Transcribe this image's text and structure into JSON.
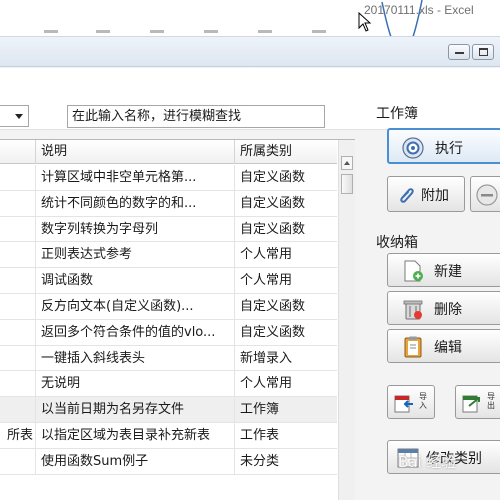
{
  "excel": {
    "title": "20170111.xls - Excel"
  },
  "search": {
    "placeholder": "在此输入名称，进行模糊查找"
  },
  "table": {
    "columns": [
      "说明",
      "所属类别"
    ],
    "rows": [
      {
        "name": "",
        "description": "计算区域中非空单元格第...",
        "category": "自定义函数"
      },
      {
        "name": "",
        "description": "统计不同颜色的数字的和...",
        "category": "自定义函数"
      },
      {
        "name": "",
        "description": "数字列转换为字母列",
        "category": "自定义函数"
      },
      {
        "name": "",
        "description": "正则表达式参考",
        "category": "个人常用"
      },
      {
        "name": "",
        "description": "调试函数",
        "category": "个人常用"
      },
      {
        "name": "",
        "description": "反方向文本(自定义函数)...",
        "category": "自定义函数"
      },
      {
        "name": "",
        "description": "返回多个符合条件的值的vlo...",
        "category": "自定义函数"
      },
      {
        "name": "",
        "description": "一键插入斜线表头",
        "category": "新增录入"
      },
      {
        "name": "",
        "description": "无说明",
        "category": "个人常用"
      },
      {
        "name": "",
        "description": "以当前日期为名另存文件",
        "category": "工作簿"
      },
      {
        "name": "所表",
        "description": "以指定区域为表目录补充新表",
        "category": "工作表"
      },
      {
        "name": "",
        "description": "使用函数Sum例子",
        "category": "未分类"
      }
    ]
  },
  "panel": {
    "workbook_title": "工作簿",
    "execute_label": "执行",
    "attach_label": "附加",
    "storage_title": "收纳箱",
    "new_label": "新建",
    "delete_label": "删除",
    "edit_label": "编辑",
    "import_label": "导入",
    "export_label": "导出",
    "modify_category_label": "修改类别"
  },
  "watermark": {
    "text": "Bai 经验"
  },
  "colors": {
    "accent": "#4a8fd3",
    "highlight_row": "#efefef",
    "panel_bg": "#f3f3f3"
  }
}
